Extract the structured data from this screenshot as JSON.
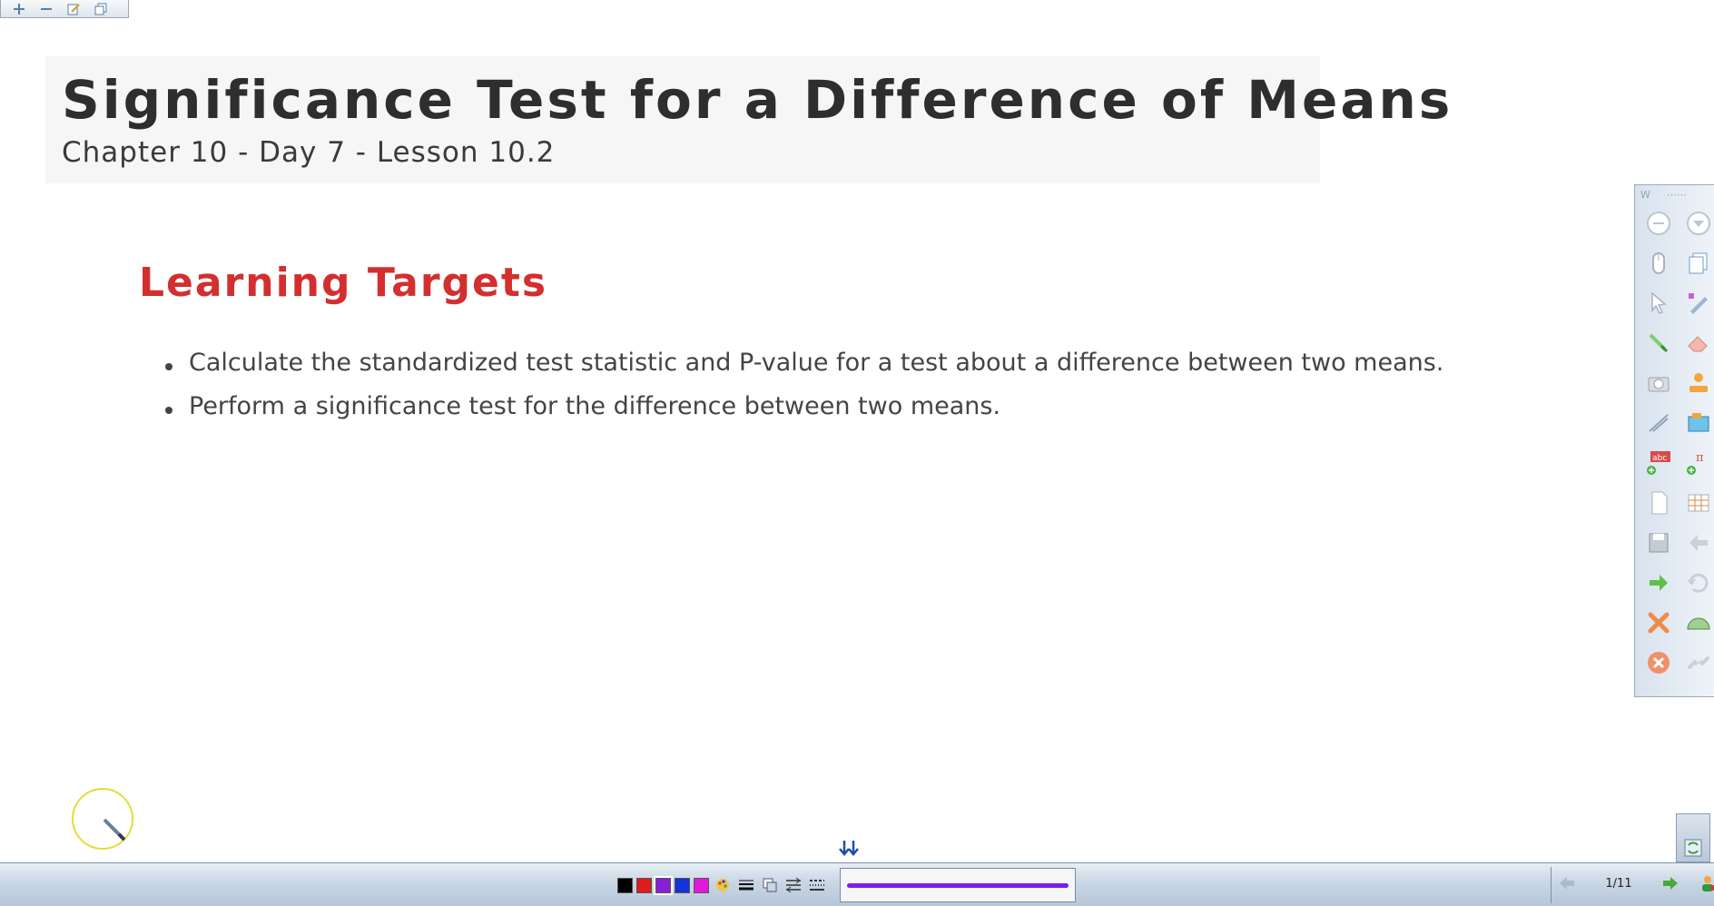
{
  "title_card": {
    "title": "Significance Test for a Difference of Means",
    "subtitle": "Chapter 10 - Day 7 - Lesson 10.2"
  },
  "learning_targets": {
    "heading": "Learning Targets",
    "items": [
      "Calculate the standardized test statistic and P-value for a test about a difference between two means.",
      "Perform a significance test for the difference between two means."
    ]
  },
  "mini_toolbar": {
    "icons": [
      "add-icon",
      "minus-icon",
      "edit-icon",
      "copy-icon"
    ]
  },
  "right_toolbar": {
    "tools": [
      "minimize-icon",
      "dropdown-icon",
      "mouse-icon",
      "pages-icon",
      "select-arrow-icon",
      "highlighter-icon",
      "pen-icon",
      "eraser-icon",
      "camera-icon",
      "stamp-icon",
      "line-tool-icon",
      "screen-capture-icon",
      "text-icon",
      "math-icon",
      "blank-page-icon",
      "grid-page-icon",
      "save-icon",
      "back-icon",
      "forward-icon",
      "undo-icon",
      "clear-icon",
      "protractor-icon",
      "close-icon",
      "link-icon"
    ]
  },
  "bottom_bar": {
    "colors": [
      "#000000",
      "#e01b1b",
      "#8a1fd8",
      "#1533d8",
      "#e01ad8"
    ],
    "selected_color": "#7b1cf0",
    "page_indicator": "1/11"
  }
}
